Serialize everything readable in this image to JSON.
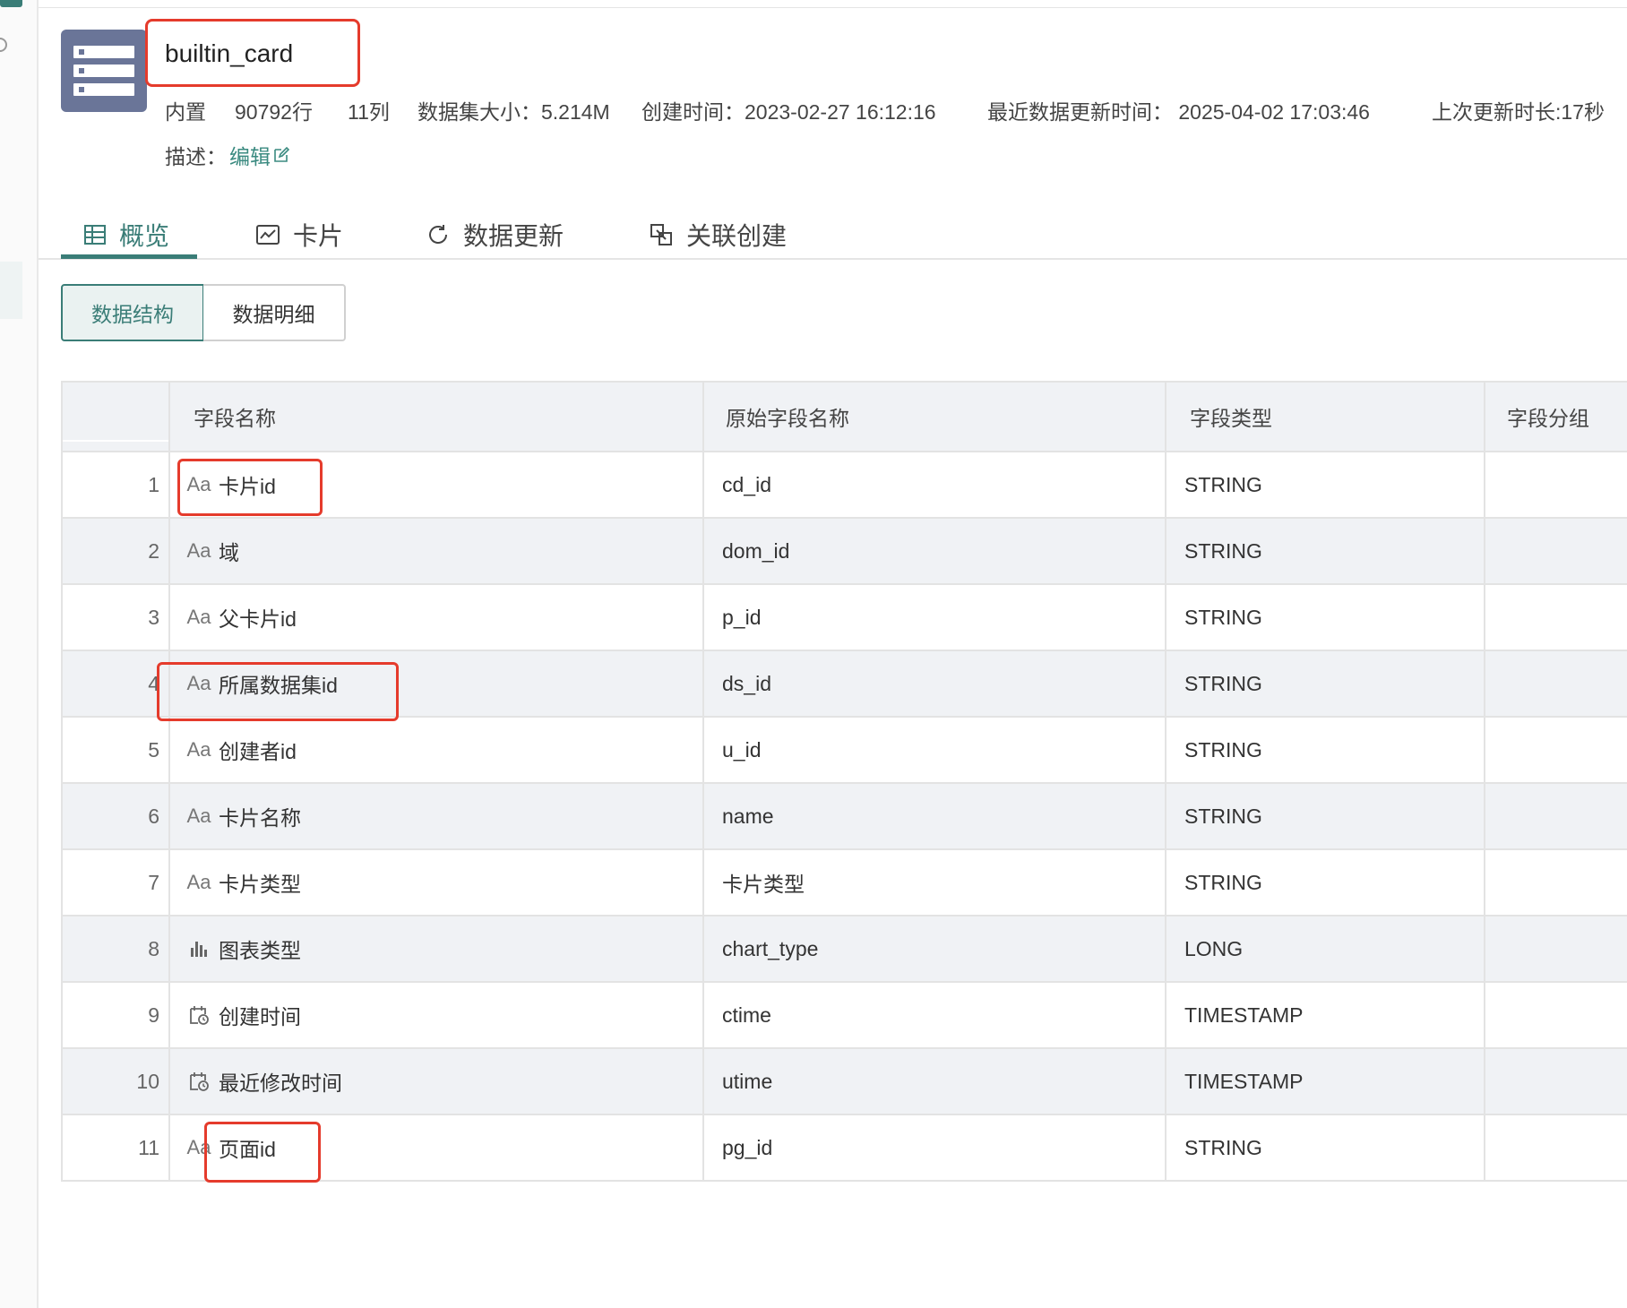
{
  "dataset": {
    "title": "builtin_card",
    "meta": {
      "type": "内置",
      "rows": "90792行",
      "cols": "11列",
      "size": "数据集大小：5.214M",
      "created": "创建时间：2023-02-27 16:12:16",
      "updated": "最近数据更新时间：  2025-04-02 17:03:46",
      "last_duration": "上次更新时长:17秒"
    },
    "desc_label": "描述：",
    "edit_label": "编辑"
  },
  "tabs": [
    {
      "label": "概览",
      "icon": "table-icon",
      "active": true
    },
    {
      "label": "卡片",
      "icon": "chart-card-icon"
    },
    {
      "label": "数据更新",
      "icon": "refresh-icon"
    },
    {
      "label": "关联创建",
      "icon": "link-create-icon"
    }
  ],
  "segments": {
    "structure": "数据结构",
    "detail": "数据明细"
  },
  "table": {
    "headers": {
      "name": "字段名称",
      "orig": "原始字段名称",
      "type": "字段类型",
      "group": "字段分组"
    },
    "rows": [
      {
        "idx": "1",
        "icon": "Aa",
        "name": "卡片id",
        "orig": "cd_id",
        "type": "STRING"
      },
      {
        "idx": "2",
        "icon": "Aa",
        "name": "域",
        "orig": "dom_id",
        "type": "STRING"
      },
      {
        "idx": "3",
        "icon": "Aa",
        "name": "父卡片id",
        "orig": "p_id",
        "type": "STRING"
      },
      {
        "idx": "4",
        "icon": "Aa",
        "name": "所属数据集id",
        "orig": "ds_id",
        "type": "STRING"
      },
      {
        "idx": "5",
        "icon": "Aa",
        "name": "创建者id",
        "orig": "u_id",
        "type": "STRING"
      },
      {
        "idx": "6",
        "icon": "Aa",
        "name": "卡片名称",
        "orig": "name",
        "type": "STRING"
      },
      {
        "idx": "7",
        "icon": "Aa",
        "name": "卡片类型",
        "orig": "卡片类型",
        "type": "STRING"
      },
      {
        "idx": "8",
        "icon": "bar-chart-icon",
        "name": "图表类型",
        "orig": "chart_type",
        "type": "LONG"
      },
      {
        "idx": "9",
        "icon": "calendar-clock-icon",
        "name": "创建时间",
        "orig": "ctime",
        "type": "TIMESTAMP"
      },
      {
        "idx": "10",
        "icon": "calendar-clock-icon",
        "name": "最近修改时间",
        "orig": "utime",
        "type": "TIMESTAMP"
      },
      {
        "idx": "11",
        "icon": "Aa",
        "name": "页面id",
        "orig": "pg_id",
        "type": "STRING"
      }
    ]
  },
  "colors": {
    "accent": "#3a7d77",
    "highlight": "#e53b2c",
    "dataset_icon": "#6a7598"
  }
}
